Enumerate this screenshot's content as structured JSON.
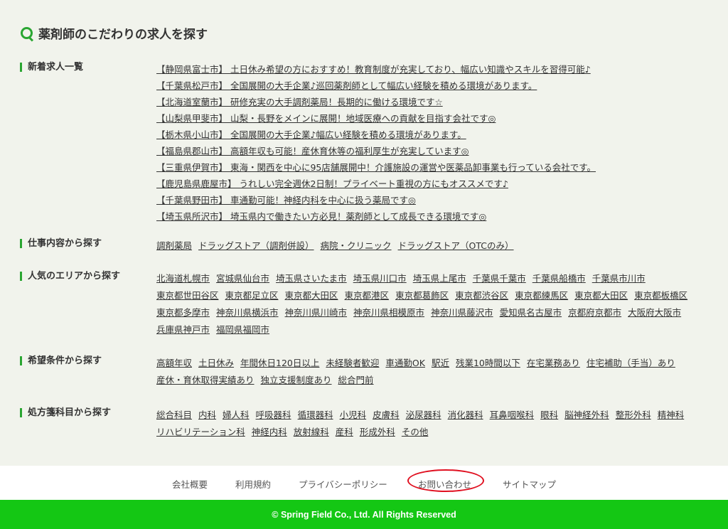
{
  "page": {
    "heading": "薬剤師のこだわりの求人を探す",
    "accent_color": "#2aa632",
    "footer_bar_color": "#14c714",
    "highlight_color": "#e01020"
  },
  "sections": {
    "new_jobs": {
      "label": "新着求人一覧",
      "items": [
        "【静岡県富士市】 土日休み希望の方におすすめ！教育制度が充実しており、幅広い知識やスキルを習得可能♪",
        "【千葉県松戸市】 全国展開の大手企業♪巡回薬剤師として幅広い経験を積める環境があります。",
        "【北海道室蘭市】 研修充実の大手調剤薬局！長期的に働ける環境です☆",
        "【山梨県甲斐市】 山梨・長野をメインに展開！地域医療への貢献を目指す会社です◎",
        "【栃木県小山市】 全国展開の大手企業♪幅広い経験を積める環境があります。",
        "【福島県郡山市】 高額年収も可能！産休育休等の福利厚生が充実しています◎",
        "【三重県伊賀市】 東海・関西を中心に95店舗展開中！介護施設の運営や医薬品卸事業も行っている会社です。",
        "【鹿児島県鹿屋市】 うれしい完全週休2日制！プライベート重視の方にもオススメです♪",
        "【千葉県野田市】 車通勤可能！神経内科を中心に扱う薬局です◎",
        "【埼玉県所沢市】 埼玉県内で働きたい方必見！薬剤師として成長できる環境です◎"
      ]
    },
    "job_type": {
      "label": "仕事内容から探す",
      "items": [
        "調剤薬局",
        "ドラッグストア（調剤併設）",
        "病院・クリニック",
        "ドラッグストア（OTCのみ）"
      ]
    },
    "area": {
      "label": "人気のエリアから探す",
      "items": [
        "北海道札幌市",
        "宮城県仙台市",
        "埼玉県さいたま市",
        "埼玉県川口市",
        "埼玉県上尾市",
        "千葉県千葉市",
        "千葉県船橋市",
        "千葉県市川市",
        "東京都世田谷区",
        "東京都足立区",
        "東京都大田区",
        "東京都港区",
        "東京都葛飾区",
        "東京都渋谷区",
        "東京都練馬区",
        "東京都大田区",
        "東京都板橋区",
        "東京都多摩市",
        "神奈川県横浜市",
        "神奈川県川崎市",
        "神奈川県相模原市",
        "神奈川県藤沢市",
        "愛知県名古屋市",
        "京都府京都市",
        "大阪府大阪市",
        "兵庫県神戸市",
        "福岡県福岡市"
      ]
    },
    "conditions": {
      "label": "希望条件から探す",
      "items": [
        "高額年収",
        "土日休み",
        "年間休日120日以上",
        "未経験者歓迎",
        "車通勤OK",
        "駅近",
        "残業10時間以下",
        "在宅業務あり",
        "住宅補助（手当）あり",
        "産休・育休取得実績あり",
        "独立支援制度あり",
        "総合門前"
      ]
    },
    "specialty": {
      "label": "処方箋科目から探す",
      "items": [
        "総合科目",
        "内科",
        "婦人科",
        "呼吸器科",
        "循環器科",
        "小児科",
        "皮膚科",
        "泌尿器科",
        "消化器科",
        "耳鼻咽喉科",
        "眼科",
        "脳神経外科",
        "整形外科",
        "精神科",
        "リハビリテーション科",
        "神経内科",
        "放射線科",
        "産科",
        "形成外科",
        "その他"
      ]
    }
  },
  "footer": {
    "links": [
      "会社概要",
      "利用規約",
      "プライバシーポリシー",
      "お問い合わせ",
      "サイトマップ"
    ],
    "copyright": "© Spring Field Co., Ltd. All Rights Reserved"
  }
}
